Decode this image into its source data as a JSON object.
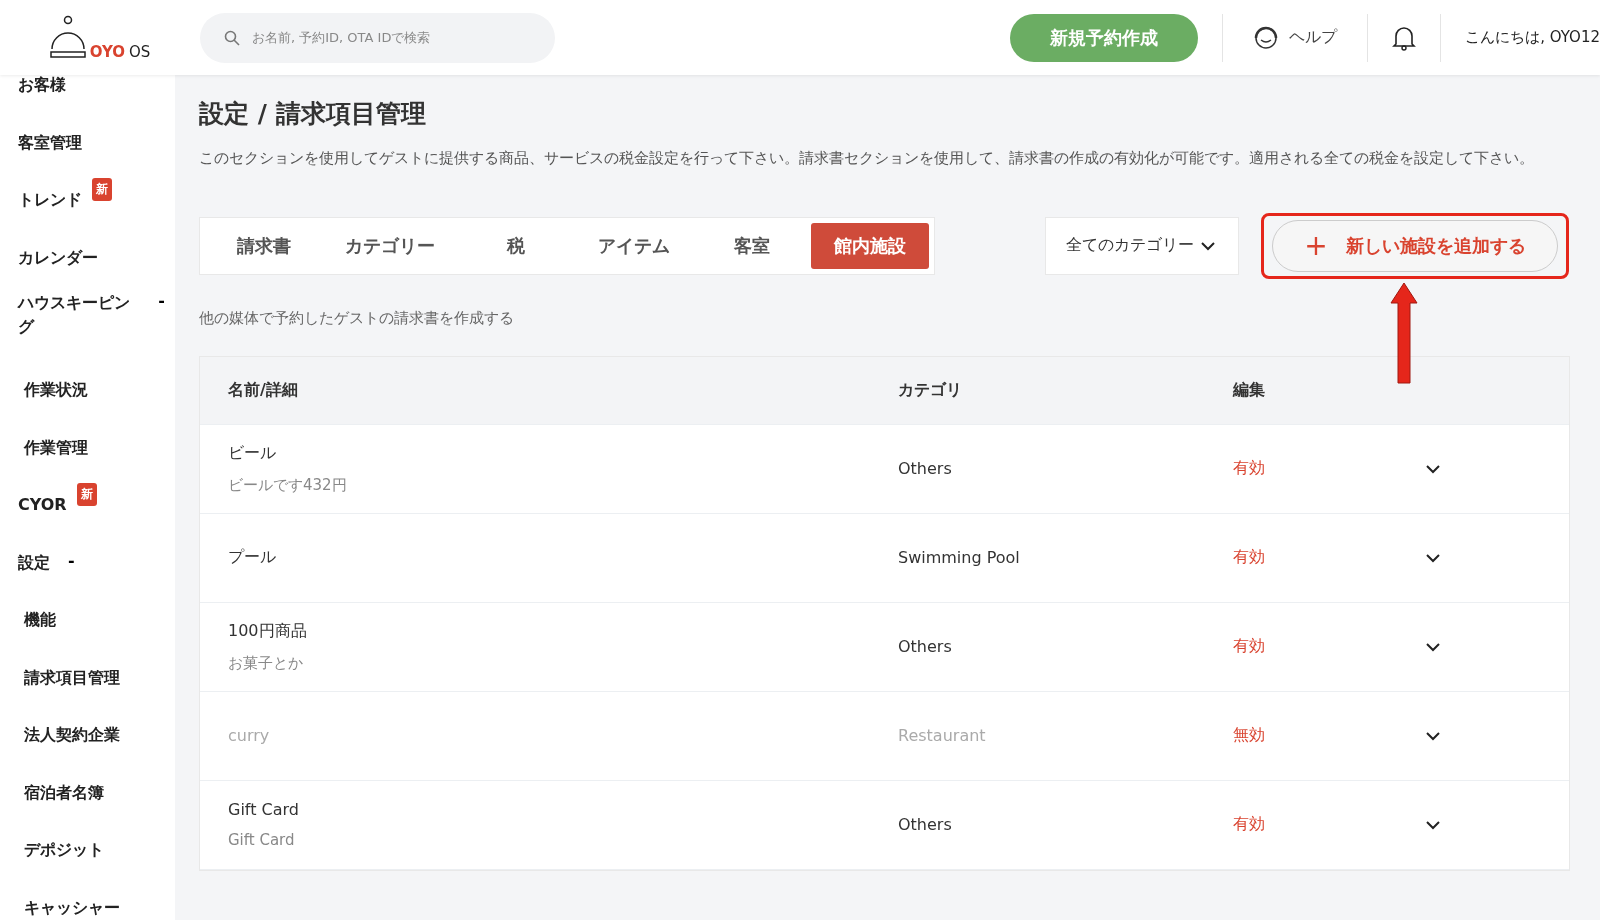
{
  "header": {
    "logo": {
      "brand": "OYO",
      "suffix": "OS"
    },
    "search": {
      "placeholder": "お名前, 予約ID, OTA IDで検索"
    },
    "new_booking_button": "新規予約作成",
    "help": "ヘルプ",
    "greeting": "こんにちは, OYO12"
  },
  "sidebar": {
    "items": [
      {
        "label": "お客様",
        "kind": "top"
      },
      {
        "label": "客室管理",
        "kind": "top"
      },
      {
        "label": "トレンド",
        "kind": "top",
        "badge": "新"
      },
      {
        "label": "カレンダー",
        "kind": "top"
      },
      {
        "label": "ハウスキーピング",
        "kind": "top",
        "toggle": "-"
      },
      {
        "label": "作業状況",
        "kind": "sub"
      },
      {
        "label": "作業管理",
        "kind": "sub"
      },
      {
        "label": "CYOR",
        "kind": "top",
        "badge": "新"
      },
      {
        "label": "設定",
        "kind": "top",
        "toggle": "-"
      },
      {
        "label": "機能",
        "kind": "sub"
      },
      {
        "label": "請求項目管理",
        "kind": "sub"
      },
      {
        "label": "法人契約企業",
        "kind": "sub"
      },
      {
        "label": "宿泊者名簿",
        "kind": "sub"
      },
      {
        "label": "デポジット",
        "kind": "sub"
      },
      {
        "label": "キャッシャー",
        "kind": "sub"
      }
    ]
  },
  "page": {
    "title": "設定 / 請求項目管理",
    "description": "このセクションを使用してゲストに提供する商品、サービスの税金設定を行って下さい。請求書セクションを使用して、請求書の作成の有効化が可能です。適用される全ての税金を設定して下さい。",
    "tabs": [
      {
        "label": "請求書",
        "selected": false
      },
      {
        "label": "カテゴリー",
        "selected": false
      },
      {
        "label": "税",
        "selected": false
      },
      {
        "label": "アイテム",
        "selected": false
      },
      {
        "label": "客室",
        "selected": false
      },
      {
        "label": "館内施設",
        "selected": true
      }
    ],
    "category_filter": "全てのカテゴリー",
    "add_button": {
      "icon": "+",
      "label": "新しい施設を追加する"
    },
    "subtitle": "他の媒体で予約したゲストの請求書を作成する",
    "table": {
      "columns": [
        "名前/詳細",
        "カテゴリ",
        "編集"
      ],
      "rows": [
        {
          "name": "ビール",
          "detail": "ビールです432円",
          "category": "Others",
          "status": "有効",
          "active": true
        },
        {
          "name": "プール",
          "category": "Swimming Pool",
          "status": "有効",
          "active": true
        },
        {
          "name": "100円商品",
          "detail": "お菓子とか",
          "category": "Others",
          "status": "有効",
          "active": true
        },
        {
          "name": "curry",
          "category": "Restaurant",
          "status": "無効",
          "active": false
        },
        {
          "name": "Gift Card",
          "detail": "Gift Card",
          "category": "Others",
          "status": "有効",
          "active": true
        }
      ]
    }
  }
}
